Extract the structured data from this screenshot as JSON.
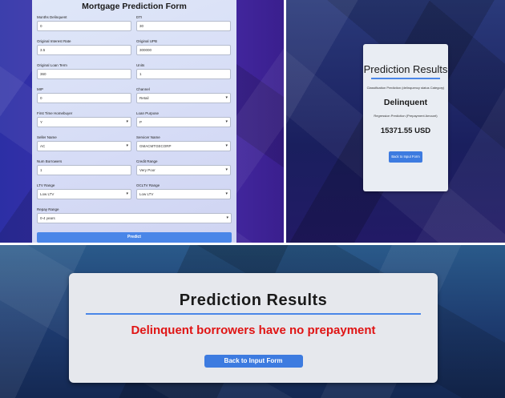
{
  "form": {
    "title": "Mortgage Prediction Form",
    "fields": [
      {
        "label": "Months Delinquent",
        "value": "0",
        "type": "input"
      },
      {
        "label": "DTI",
        "value": "30",
        "type": "input"
      },
      {
        "label": "Original Interest Rate",
        "value": "3.5",
        "type": "input"
      },
      {
        "label": "Original UPB",
        "value": "300000",
        "type": "input"
      },
      {
        "label": "Original Loan Term",
        "value": "360",
        "type": "input"
      },
      {
        "label": "Units",
        "value": "1",
        "type": "input"
      },
      {
        "label": "MIP",
        "value": "0",
        "type": "input"
      },
      {
        "label": "Channel",
        "value": "Retail",
        "type": "select"
      },
      {
        "label": "First Time Homebuyer",
        "value": "Y",
        "type": "select"
      },
      {
        "label": "Loan Purpose",
        "value": "P",
        "type": "select"
      },
      {
        "label": "Seller Name",
        "value": "AC",
        "type": "select"
      },
      {
        "label": "Servicer Name",
        "value": "GMACMTGECORP",
        "type": "select"
      },
      {
        "label": "Num Borrowers",
        "value": "1",
        "type": "input"
      },
      {
        "label": "Credit Range",
        "value": "Very Poor",
        "type": "select"
      },
      {
        "label": "LTV Range",
        "value": "Low LTV",
        "type": "select"
      },
      {
        "label": "OCLTV Range",
        "value": "Low LTV",
        "type": "select"
      },
      {
        "label": "Repay Range",
        "value": "0-4 years",
        "type": "select"
      }
    ],
    "predict_label": "Predict",
    "chevron": "▾"
  },
  "results_small": {
    "title": "Prediction Results",
    "classification_label": "Classification Prediction (delinquency status Category)",
    "classification_value": "Delinquent",
    "regression_label": "Regression Prediction (Prepayment Amount)",
    "regression_value": "15371.55 USD",
    "back_label": "Back to Input Form"
  },
  "results_large": {
    "title": "Prediction Results",
    "message": "Delinquent borrowers have no prepayment",
    "back_label": "Back to Input Form"
  },
  "colors": {
    "accent": "#4a86e8",
    "error_text": "#e01414"
  }
}
